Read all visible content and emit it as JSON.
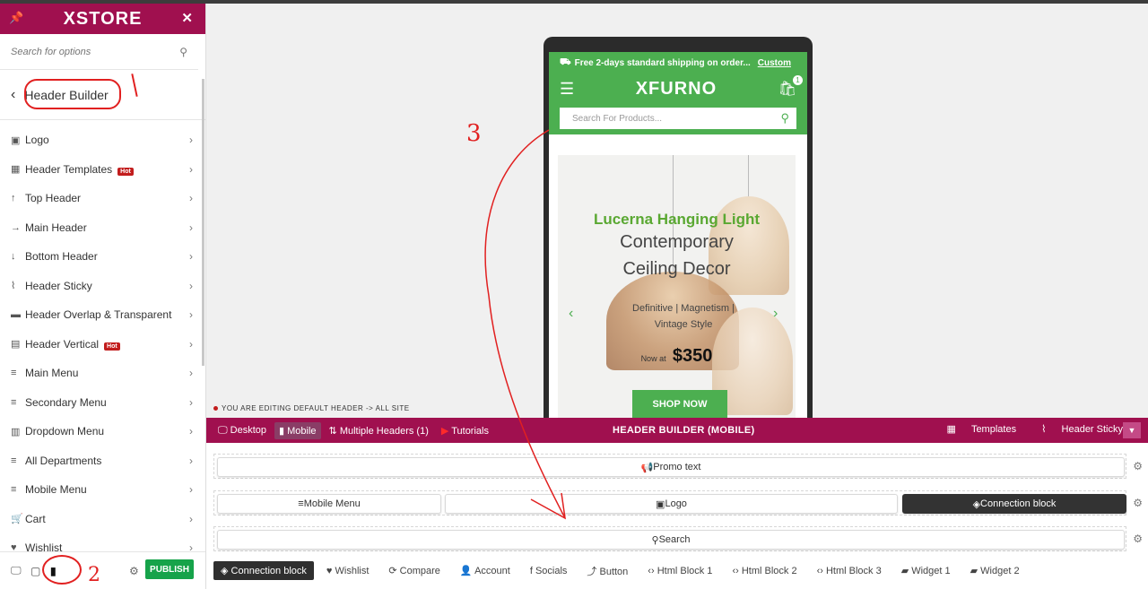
{
  "sidebar": {
    "logo": "XSTORE",
    "search_placeholder": "Search for options",
    "section_title": "Header Builder",
    "items": [
      {
        "label": "Logo",
        "icon": "image-icon",
        "hot": ""
      },
      {
        "label": "Header Templates",
        "icon": "grid-icon",
        "hot": "Hot"
      },
      {
        "label": "Top Header",
        "icon": "arrow-up-icon",
        "hot": ""
      },
      {
        "label": "Main Header",
        "icon": "arrow-right-icon",
        "hot": ""
      },
      {
        "label": "Bottom Header",
        "icon": "arrow-down-icon",
        "hot": ""
      },
      {
        "label": "Header Sticky",
        "icon": "paperclip-icon",
        "hot": ""
      },
      {
        "label": "Header Overlap & Transparent",
        "icon": "panel-icon",
        "hot": ""
      },
      {
        "label": "Header Vertical",
        "icon": "vertical-icon",
        "hot": "Hot"
      },
      {
        "label": "Main Menu",
        "icon": "menu-icon",
        "hot": ""
      },
      {
        "label": "Secondary Menu",
        "icon": "menu-icon",
        "hot": ""
      },
      {
        "label": "Dropdown Menu",
        "icon": "dropdown-icon",
        "hot": ""
      },
      {
        "label": "All Departments",
        "icon": "menu-icon",
        "hot": ""
      },
      {
        "label": "Mobile Menu",
        "icon": "menu-icon",
        "hot": ""
      },
      {
        "label": "Cart",
        "icon": "cart-icon",
        "hot": ""
      },
      {
        "label": "Wishlist",
        "icon": "heart-icon",
        "hot": ""
      }
    ],
    "publish_label": "PUBLISH"
  },
  "preview": {
    "promo_text": "Free 2-days standard shipping on order...",
    "promo_link": "Custom",
    "store_logo": "XFURNO",
    "cart_count": "1",
    "search_placeholder": "Search For Products...",
    "banner": {
      "title": "Lucerna Hanging Light",
      "subtitle_line1": "Contemporary",
      "subtitle_line2": "Ceiling Decor",
      "tags_line1": "Definitive  |  Magnetism  |",
      "tags_line2": "Vintage Style",
      "now_at": "Now at",
      "price": "$350",
      "button": "SHOP NOW"
    },
    "editing_label": "YOU ARE EDITING DEFAULT HEADER -> ALL SITE"
  },
  "builder": {
    "tabs": {
      "desktop": "Desktop",
      "mobile": "Mobile",
      "multiple": "Multiple Headers (1)",
      "tutorials": "Tutorials"
    },
    "title": "HEADER BUILDER (MOBILE)",
    "templates": "Templates",
    "header_sticky": "Header Sticky",
    "rows": {
      "promo": "Promo text",
      "mobile_menu": "Mobile Menu",
      "logo": "Logo",
      "connection": "Connection block",
      "search": "Search"
    },
    "elements": [
      "Connection block",
      "Wishlist",
      "Compare",
      "Account",
      "Socials",
      "Button",
      "Html Block 1",
      "Html Block 2",
      "Html Block 3",
      "Widget 1",
      "Widget 2"
    ]
  },
  "annotations": {
    "mark1": "1",
    "mark2": "2",
    "mark3": "3"
  },
  "colors": {
    "brand": "#a0104f",
    "store_green": "#4caf50",
    "annotation_red": "#e12020",
    "publish_green": "#16a34a"
  }
}
